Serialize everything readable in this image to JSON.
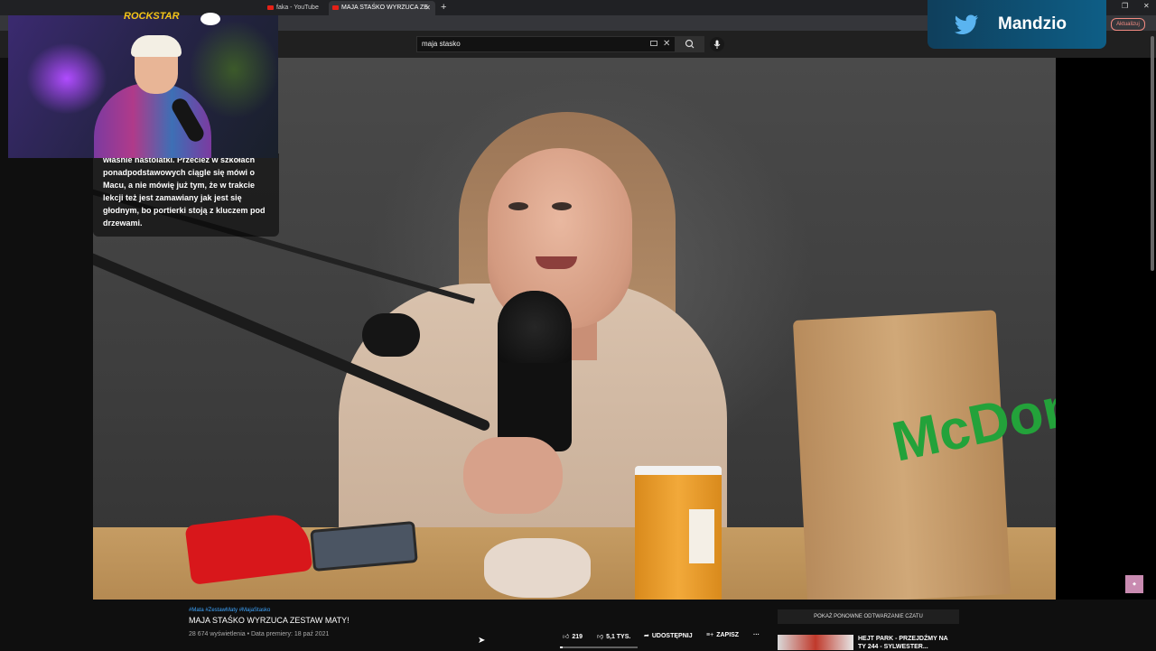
{
  "browser": {
    "tabs": [
      {
        "label": "faka - YouTube"
      },
      {
        "label": "MAJA STAŚKO WYRZUCA ZE"
      }
    ],
    "new_tab_symbol": "+",
    "update_button": "Aktualizuj"
  },
  "youtube": {
    "search": {
      "value": "maja stasko"
    },
    "video": {
      "hashtags": "#Mata #ZestawMaty #MajaStasko",
      "title": "MAJA STAŚKO WYRZUCA ZESTAW MATY!",
      "meta": "28 674 wyświetlenia • Data premiery: 18 paź 2021",
      "likes": "219",
      "dislikes": "5,1 TYS.",
      "share_label": "UDOSTĘPNIJ",
      "save_label": "ZAPISZ",
      "more_label": "···",
      "like_ratio": 0.04
    },
    "chat_replay_label": "POKAŻ PONOWNE ODTWARZANIE CZATU",
    "recommendation": {
      "title": "HEJT PARK - PRZEJDŹMY NA TY 244 - SYLWESTER..."
    }
  },
  "stream_overlay": {
    "chat_message": "właśnie nastolatki. Przecież w szkołach ponadpodstawowych ciągle się mówi o Macu, a nie mówię już tym, że w trakcie lekcji też jest zamawiany jak jest się głodnym, bo portierki stoją z kluczem pod drzewami.",
    "twitter_handle": "Mandzio",
    "sponsor_logo": "ROCKSTAR",
    "bag_text": "McDonald's"
  },
  "colors": {
    "accent_link": "#3ea6ff",
    "twitter_blue": "#5ab4f0",
    "mcd_green": "#23a23a"
  }
}
